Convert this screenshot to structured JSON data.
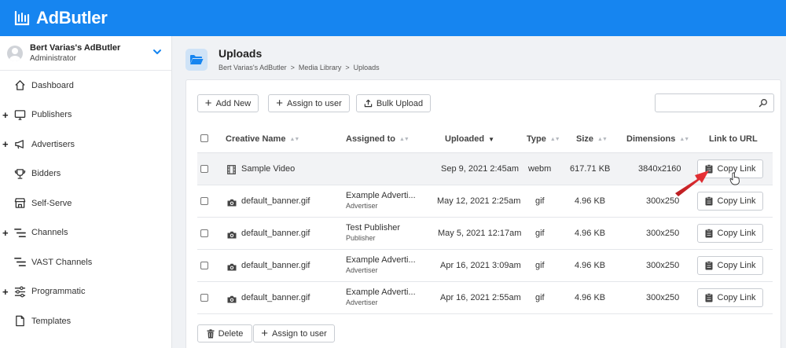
{
  "app": {
    "name": "AdButler"
  },
  "account": {
    "name": "Bert Varias's AdButler",
    "role": "Administrator"
  },
  "sidebar": {
    "items": [
      {
        "label": "Dashboard",
        "icon": "home-icon",
        "expandable": false
      },
      {
        "label": "Publishers",
        "icon": "monitor-icon",
        "expandable": true
      },
      {
        "label": "Advertisers",
        "icon": "megaphone-icon",
        "expandable": true
      },
      {
        "label": "Bidders",
        "icon": "trophy-icon",
        "expandable": false
      },
      {
        "label": "Self-Serve",
        "icon": "store-icon",
        "expandable": false
      },
      {
        "label": "Channels",
        "icon": "channels-icon",
        "expandable": true
      },
      {
        "label": "VAST Channels",
        "icon": "channels-icon",
        "expandable": false
      },
      {
        "label": "Programmatic",
        "icon": "sliders-icon",
        "expandable": true
      },
      {
        "label": "Templates",
        "icon": "document-icon",
        "expandable": false
      }
    ]
  },
  "page": {
    "title": "Uploads",
    "breadcrumb": "Bert Varias's AdButler  >  Media Library  >  Uploads"
  },
  "toolbar": {
    "add_new": "Add New",
    "assign_to_user": "Assign to user",
    "bulk_upload": "Bulk Upload",
    "search_placeholder": ""
  },
  "table": {
    "columns": [
      "Creative Name",
      "Assigned to",
      "Uploaded",
      "Type",
      "Size",
      "Dimensions",
      "Link to URL"
    ],
    "rows": [
      {
        "name": "Sample Video",
        "icon": "film-icon",
        "assigned_name": "",
        "assigned_role": "",
        "uploaded": "Sep 9, 2021 2:45am",
        "type": "webm",
        "size": "617.71 KB",
        "dimensions": "3840x2160",
        "link": "Copy Link"
      },
      {
        "name": "default_banner.gif",
        "icon": "camera-icon",
        "assigned_name": "Example Adverti...",
        "assigned_role": "Advertiser",
        "uploaded": "May 12, 2021 2:25am",
        "type": "gif",
        "size": "4.96 KB",
        "dimensions": "300x250",
        "link": "Copy Link"
      },
      {
        "name": "default_banner.gif",
        "icon": "camera-icon",
        "assigned_name": "Test Publisher",
        "assigned_role": "Publisher",
        "uploaded": "May 5, 2021 12:17am",
        "type": "gif",
        "size": "4.96 KB",
        "dimensions": "300x250",
        "link": "Copy Link"
      },
      {
        "name": "default_banner.gif",
        "icon": "camera-icon",
        "assigned_name": "Example Adverti...",
        "assigned_role": "Advertiser",
        "uploaded": "Apr 16, 2021 3:09am",
        "type": "gif",
        "size": "4.96 KB",
        "dimensions": "300x250",
        "link": "Copy Link"
      },
      {
        "name": "default_banner.gif",
        "icon": "camera-icon",
        "assigned_name": "Example Adverti...",
        "assigned_role": "Advertiser",
        "uploaded": "Apr 16, 2021 2:55am",
        "type": "gif",
        "size": "4.96 KB",
        "dimensions": "300x250",
        "link": "Copy Link"
      }
    ]
  },
  "footer": {
    "delete": "Delete",
    "assign_to_user": "Assign to user"
  },
  "colors": {
    "brand": "#1685f0",
    "annotation_arrow": "#e3262b"
  }
}
